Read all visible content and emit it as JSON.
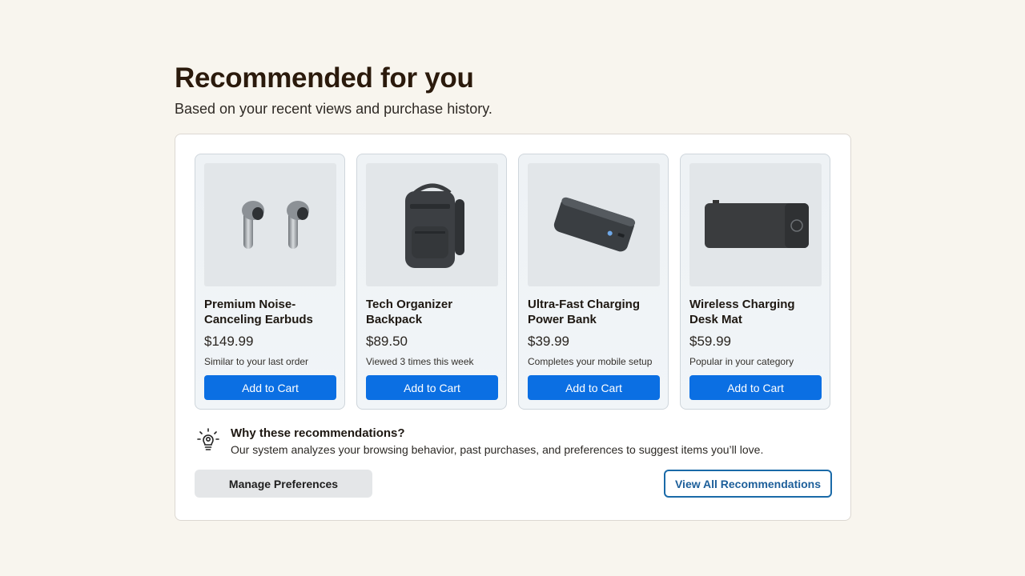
{
  "header": {
    "title": "Recommended for you",
    "subtitle": "Based on your recent views and purchase history."
  },
  "products": [
    {
      "title": "Premium Noise-Canceling Earbuds",
      "price": "$149.99",
      "reason": "Similar to your last order",
      "button": "Add to Cart",
      "image": "earbuds-image"
    },
    {
      "title": "Tech Organizer Backpack",
      "price": "$89.50",
      "reason": "Viewed 3 times this week",
      "button": "Add to Cart",
      "image": "backpack-image"
    },
    {
      "title": "Ultra-Fast Charging Power Bank",
      "price": "$39.99",
      "reason": "Completes your mobile setup",
      "button": "Add to Cart",
      "image": "power-bank-image"
    },
    {
      "title": "Wireless Charging Desk Mat",
      "price": "$59.99",
      "reason": "Popular in your category",
      "button": "Add to Cart",
      "image": "desk-mat-image"
    }
  ],
  "why": {
    "icon": "lightbulb-icon",
    "title": "Why these recommendations?",
    "text": "Our system analyzes your browsing behavior, past purchases, and preferences to suggest items you’ll love."
  },
  "actions": {
    "manage_label": "Manage Preferences",
    "view_all_label": "View All Recommendations"
  },
  "colors": {
    "accent": "#0b6fe3",
    "outline_button": "#1a6aa8",
    "background": "#f8f5ee"
  }
}
